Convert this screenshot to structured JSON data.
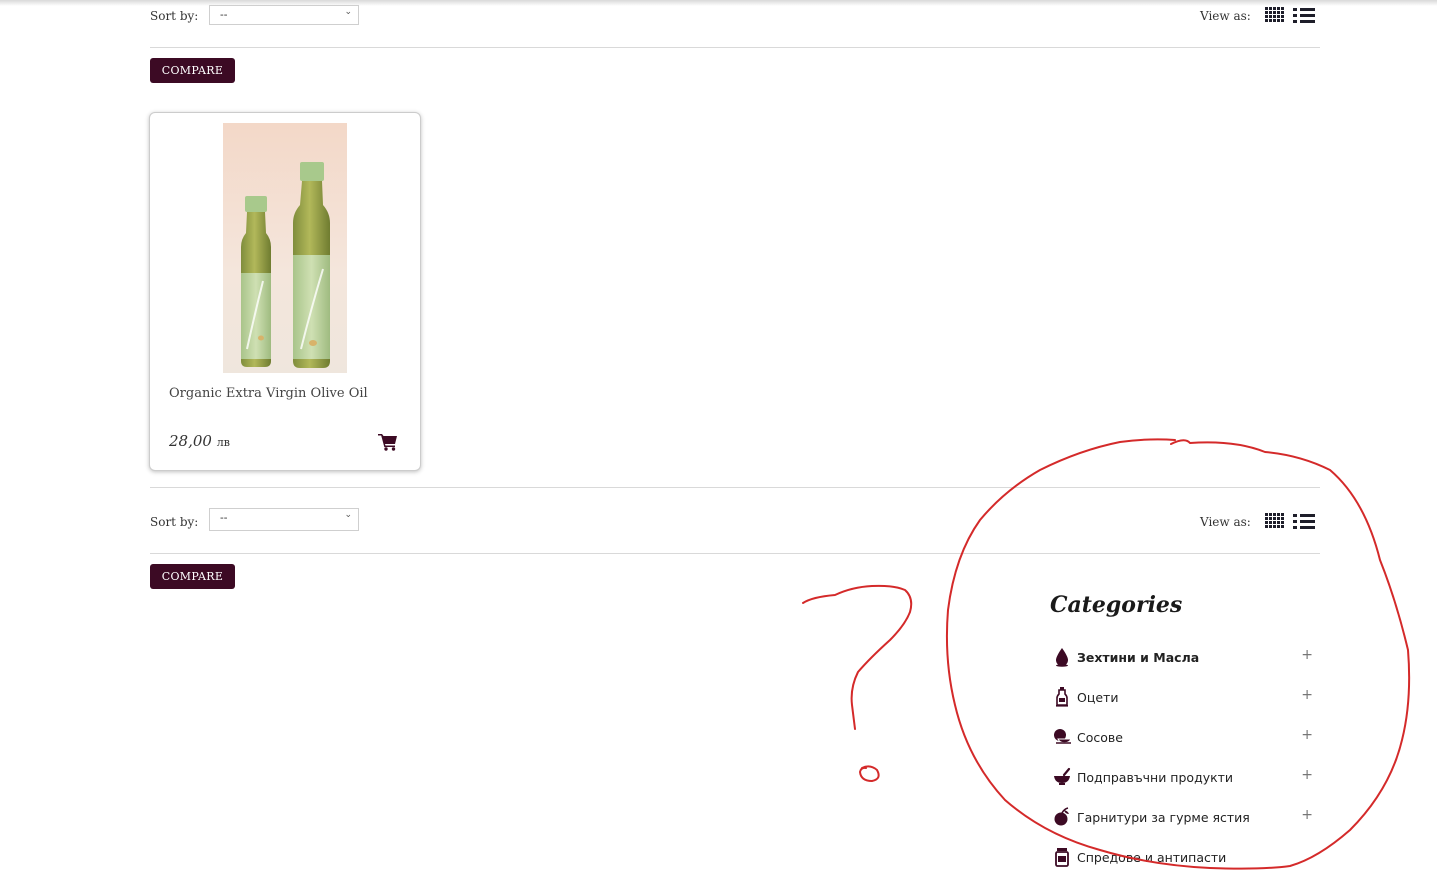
{
  "toolbar_top": {
    "sort_label": "Sort by:",
    "sort_value": "--",
    "view_label": "View as:",
    "compare_label": "COMPARE"
  },
  "toolbar_bottom": {
    "sort_label": "Sort by:",
    "sort_value": "--",
    "view_label": "View as:",
    "compare_label": "COMPARE"
  },
  "products": [
    {
      "name": "Organic Extra Virgin Olive Oil",
      "price": "28,00",
      "currency": "лв",
      "image_icon": "olive-oil-bottles-image",
      "cart_icon": "shopping-cart-icon"
    }
  ],
  "categories": {
    "title": "Categories",
    "items": [
      {
        "label": "Зехтини и Масла",
        "icon": "oil-drop-icon",
        "expand": "+"
      },
      {
        "label": "Оцети",
        "icon": "vinegar-bottle-icon",
        "expand": "+"
      },
      {
        "label": "Сосове",
        "icon": "sauce-bowl-icon",
        "expand": "+"
      },
      {
        "label": "Подправъчни продукти",
        "icon": "mortar-pestle-icon",
        "expand": "+"
      },
      {
        "label": "Гарнитури за гурме ястия",
        "icon": "garnish-fruit-icon",
        "expand": "+"
      },
      {
        "label": "Спредове и антипасти",
        "icon": "jar-icon",
        "expand": ""
      }
    ]
  },
  "colors": {
    "accent": "#3c0a24",
    "annotation": "#d42a2a",
    "divider": "#d9d9d9"
  },
  "annotation": {
    "marks": [
      "question-mark",
      "circle-around-categories"
    ]
  }
}
